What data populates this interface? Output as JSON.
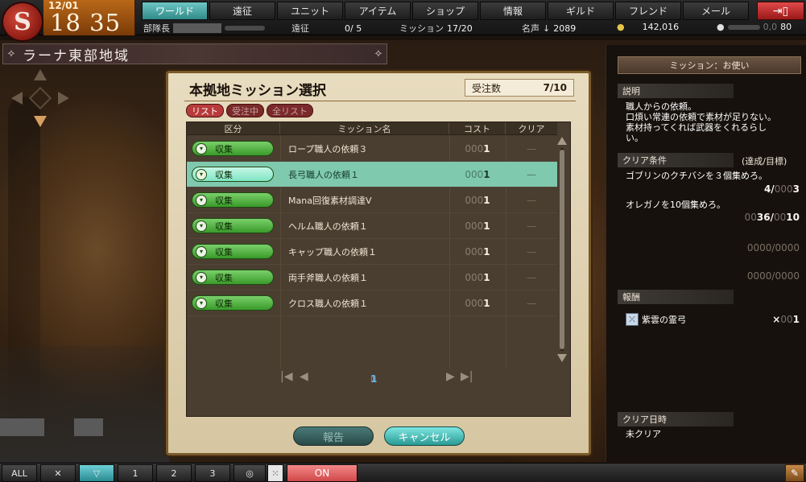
{
  "clock": {
    "date": "12/01",
    "time": "18 35"
  },
  "nav": {
    "tabs": [
      {
        "label": "ワールド",
        "active": true
      },
      {
        "label": "遠征",
        "active": false
      },
      {
        "label": "ユニット",
        "active": false
      },
      {
        "label": "アイテム",
        "active": false
      },
      {
        "label": "ショップ",
        "active": false
      },
      {
        "label": "情報",
        "active": false
      },
      {
        "label": "ギルド",
        "active": false
      },
      {
        "label": "フレンド",
        "active": false
      },
      {
        "label": "メール",
        "active": false
      }
    ],
    "exit_icon": "exit-door-icon"
  },
  "status": {
    "rank_label": "部隊長",
    "expedition_label": "遠征",
    "expedition_value": "0/ 5",
    "mission_label": "ミッション",
    "mission_value": "17/20",
    "fame_label": "名声",
    "fame_value": "2089",
    "gold_value": "142,016",
    "points_value": "80",
    "points_zeros": "0,0"
  },
  "region": {
    "title": "ラーナ東部地域"
  },
  "dialog": {
    "title": "本拠地ミッション選択",
    "order_label": "受注数",
    "order_value": "7/10",
    "filters": [
      {
        "label": "リスト",
        "active": true
      },
      {
        "label": "受注中",
        "active": false
      },
      {
        "label": "全リスト",
        "active": false
      }
    ],
    "columns": {
      "category": "区分",
      "name": "ミッション名",
      "cost": "コスト",
      "clear": "クリア"
    },
    "rows": [
      {
        "category": "収集",
        "name": "ロープ職人の依頼３",
        "cost_zeros": "000",
        "cost": "1",
        "clear": "—",
        "selected": false
      },
      {
        "category": "収集",
        "name": "長弓職人の依頼１",
        "cost_zeros": "000",
        "cost": "1",
        "clear": "—",
        "selected": true
      },
      {
        "category": "収集",
        "name": "Mana回復素材調達Ⅴ",
        "cost_zeros": "000",
        "cost": "1",
        "clear": "—",
        "selected": false
      },
      {
        "category": "収集",
        "name": "ヘルム職人の依頼１",
        "cost_zeros": "000",
        "cost": "1",
        "clear": "—",
        "selected": false
      },
      {
        "category": "収集",
        "name": "キャップ職人の依頼１",
        "cost_zeros": "000",
        "cost": "1",
        "clear": "—",
        "selected": false
      },
      {
        "category": "収集",
        "name": "両手斧職人の依頼１",
        "cost_zeros": "000",
        "cost": "1",
        "clear": "—",
        "selected": false
      },
      {
        "category": "収集",
        "name": "クロス職人の依頼１",
        "cost_zeros": "000",
        "cost": "1",
        "clear": "—",
        "selected": false
      }
    ],
    "pager": {
      "first": "|◀",
      "prev": "◀",
      "page_zero": "0",
      "page": "1",
      "next": "▶",
      "last": "▶|"
    },
    "report_button": "報告",
    "cancel_button": "キャンセル"
  },
  "detail": {
    "header": "ミッション：お使い",
    "desc_title": "説明",
    "desc_lines": [
      "職人からの依頼。",
      "口煩い常連の依頼で素材が足りない。",
      "素材持ってくれば武器をくれるらし",
      "い。"
    ],
    "cond_title": "クリア条件",
    "cond_hint": "(達成/目標)",
    "cond1_text": "ゴブリンのクチバシを３個集めろ。",
    "cond1_count": "4/",
    "cond1_zero": "000",
    "cond1_target": "3",
    "cond2_text": "オレガノを10個集めろ。",
    "cond2_zero_a": "00",
    "cond2_count": "36/",
    "cond2_zero_b": "00",
    "cond2_target": "10",
    "cond3": "0000/0000",
    "cond4": "0000/0000",
    "reward_title": "報酬",
    "reward_name": "紫雲の霊弓",
    "reward_qty_prefix": "×",
    "reward_qty_zeros": "00",
    "reward_qty": "1",
    "clear_date_title": "クリア日時",
    "clear_date_value": "未クリア"
  },
  "bottom": {
    "all_label": "ALL",
    "on_label": "ON",
    "icons": [
      "close-x-icon",
      "party-icon",
      "unit-1-icon",
      "unit-2-icon",
      "unit-3-icon",
      "target-icon",
      "dice-icon"
    ],
    "unit_labels": [
      "1",
      "2",
      "3"
    ]
  }
}
